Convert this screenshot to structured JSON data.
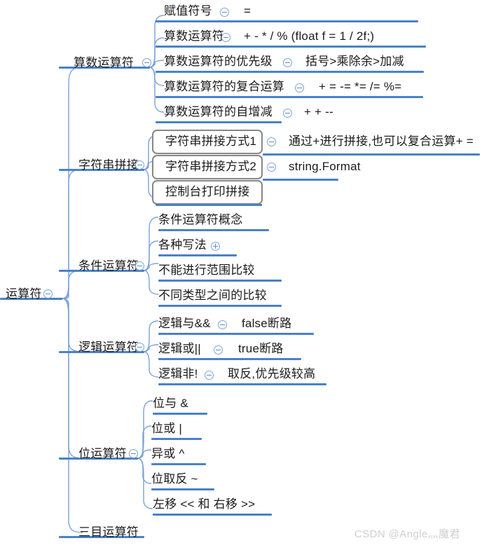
{
  "mindmap": {
    "root": {
      "label": "运算符",
      "toggle": "collapse-icon"
    },
    "branches": [
      {
        "label": "算数运算符",
        "toggle": "collapse-icon",
        "children": [
          {
            "label": "赋值符号",
            "toggle": "collapse-icon",
            "detail": "="
          },
          {
            "label": "算数运算符",
            "toggle": "collapse-icon",
            "detail": "+ - * / %  (float f = 1 / 2f;)"
          },
          {
            "label": "算数运算符的优先级",
            "toggle": "collapse-icon",
            "detail": "括号>乘除余>加减"
          },
          {
            "label": "算数运算符的复合运算",
            "toggle": "collapse-icon",
            "detail": "+ = -= *= /= %="
          },
          {
            "label": "算数运算符的自增减",
            "toggle": "collapse-icon",
            "detail": "+ + --"
          }
        ]
      },
      {
        "label": "字符串拼接",
        "toggle": "collapse-icon",
        "children": [
          {
            "label": "字符串拼接方式1",
            "toggle": "collapse-icon",
            "detail": "通过+进行拼接,也可以复合运算+ =",
            "boxed": true
          },
          {
            "label": "字符串拼接方式2",
            "toggle": "collapse-icon",
            "detail": "string.Format",
            "boxed": true
          },
          {
            "label": "控制台打印拼接",
            "toggle": "",
            "detail": "",
            "boxed": true
          }
        ]
      },
      {
        "label": "条件运算符",
        "toggle": "collapse-icon",
        "children": [
          {
            "label": "条件运算符概念",
            "toggle": "",
            "detail": ""
          },
          {
            "label": "各种写法",
            "toggle": "expand-icon",
            "detail": ""
          },
          {
            "label": "不能进行范围比较",
            "toggle": "",
            "detail": ""
          },
          {
            "label": "不同类型之间的比较",
            "toggle": "",
            "detail": ""
          }
        ]
      },
      {
        "label": "逻辑运算符",
        "toggle": "collapse-icon",
        "children": [
          {
            "label": "逻辑与&&",
            "toggle": "collapse-icon",
            "detail": "false断路"
          },
          {
            "label": "逻辑或||",
            "toggle": "collapse-icon",
            "detail": "true断路"
          },
          {
            "label": "逻辑非!",
            "toggle": "collapse-icon",
            "detail": "取反,优先级较高"
          }
        ]
      },
      {
        "label": "位运算符",
        "toggle": "collapse-icon",
        "children": [
          {
            "label": "位与 &",
            "toggle": "",
            "detail": ""
          },
          {
            "label": "位或 |",
            "toggle": "",
            "detail": ""
          },
          {
            "label": "异或 ^",
            "toggle": "",
            "detail": ""
          },
          {
            "label": "位取反 ~",
            "toggle": "",
            "detail": ""
          },
          {
            "label": "左移 << 和 右移 >>",
            "toggle": "",
            "detail": ""
          }
        ]
      },
      {
        "label": "三目运算符",
        "toggle": "",
        "children": []
      }
    ]
  },
  "watermark": {
    "text": "CSDN @Angle灬魔君"
  },
  "colors": {
    "branch_line": "#4a82c8",
    "toggle_stroke": "#7ba3d6",
    "box_border": "#878787",
    "text": "#1b1b1b",
    "watermark": "#cfcfcf"
  }
}
